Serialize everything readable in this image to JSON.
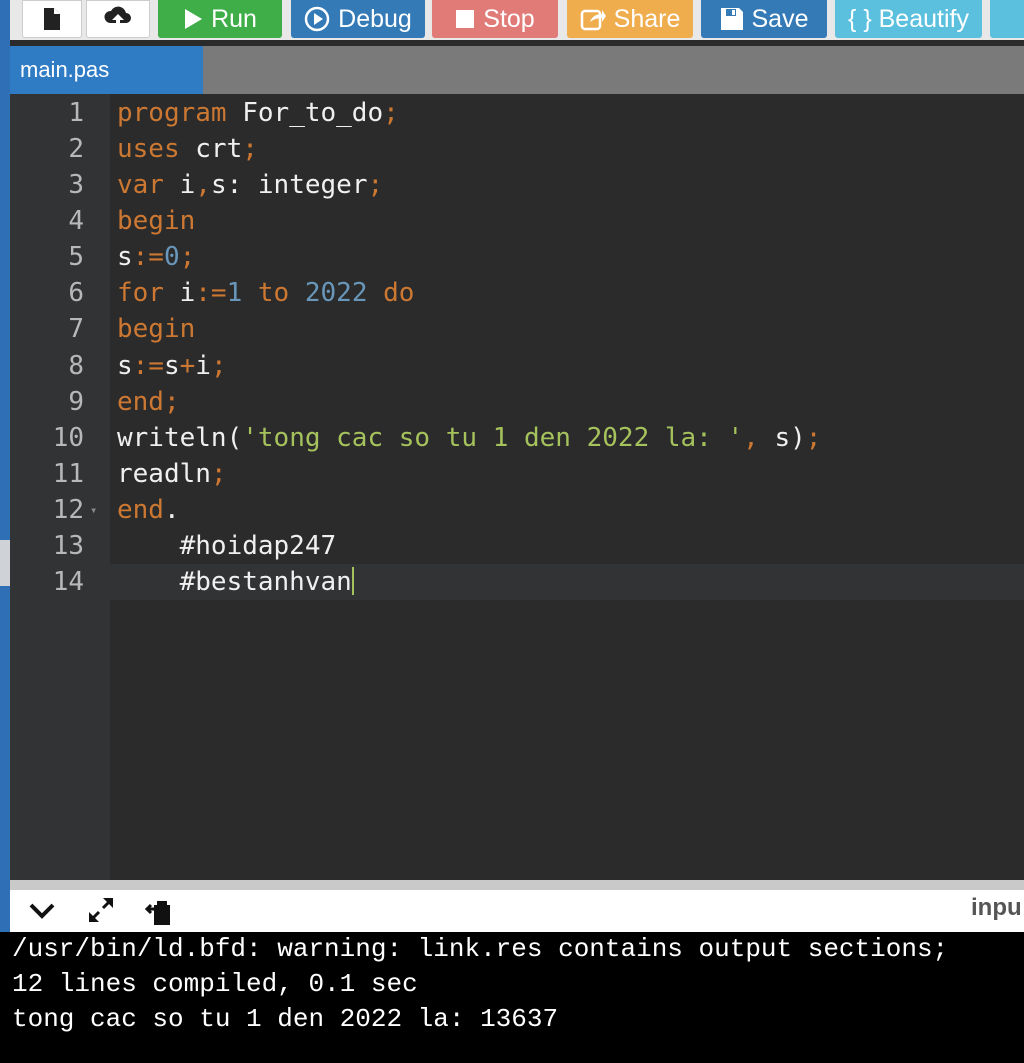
{
  "toolbar": {
    "buttons": [
      {
        "label": "",
        "icon": "file-icon",
        "color": "#ffffff"
      },
      {
        "label": "",
        "icon": "upload-icon",
        "color": "#ffffff"
      },
      {
        "label": "Run",
        "icon": "play-icon",
        "color": "#3fae49"
      },
      {
        "label": "Debug",
        "icon": "debug-icon",
        "color": "#337ab7"
      },
      {
        "label": "Stop",
        "icon": "stop-icon",
        "color": "#d9534f"
      },
      {
        "label": "Share",
        "icon": "share-icon",
        "color": "#f0ad4e"
      },
      {
        "label": "Save",
        "icon": "save-icon",
        "color": "#337ab7"
      },
      {
        "label": "{ } Beautify",
        "icon": "",
        "color": "#5bc0de"
      }
    ]
  },
  "tab": {
    "label": "main.pas"
  },
  "editor": {
    "lines": [
      {
        "n": "1",
        "text": "program For_to_do;"
      },
      {
        "n": "2",
        "text": "uses crt;"
      },
      {
        "n": "3",
        "text": "var i,s: integer;"
      },
      {
        "n": "4",
        "text": "begin"
      },
      {
        "n": "5",
        "text": "s:=0;"
      },
      {
        "n": "6",
        "text": "for i:=1 to 2022 do"
      },
      {
        "n": "7",
        "text": "begin"
      },
      {
        "n": "8",
        "text": "s:=s+i;"
      },
      {
        "n": "9",
        "text": "end;"
      },
      {
        "n": "10",
        "text": "writeln('tong cac so tu 1 den 2022 la: ', s);"
      },
      {
        "n": "11",
        "text": "readln;"
      },
      {
        "n": "12",
        "text": "end."
      },
      {
        "n": "13",
        "text": "    #hoidap247"
      },
      {
        "n": "14",
        "text": "    #bestanhvan"
      }
    ]
  },
  "output": {
    "input_label": "inpu",
    "console_lines": [
      "/usr/bin/ld.bfd: warning: link.res contains output sections;",
      "12 lines compiled, 0.1 sec",
      "tong cac so tu 1 den 2022 la: 13637"
    ]
  }
}
